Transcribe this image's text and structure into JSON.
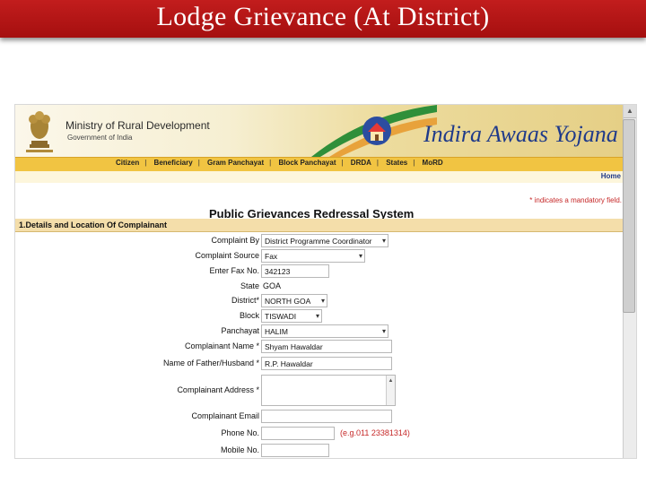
{
  "slide": {
    "title": "Lodge Grievance (At District)"
  },
  "banner": {
    "ministry": "Ministry of Rural Development",
    "government": "Government of India",
    "scheme_title": "Indira Awaas Yojana"
  },
  "nav": {
    "items": [
      "Citizen",
      "Beneficiary",
      "Gram Panchayat",
      "Block Panchayat",
      "DRDA",
      "States",
      "MoRD"
    ],
    "home": "Home"
  },
  "form": {
    "required_note": "* indicates a mandatory field.",
    "page_title": "Public Grievances Redressal System",
    "section_title": "1.Details and Location Of Complainant",
    "fields": {
      "complaint_by": {
        "label": "Complaint By",
        "value": "District Programme Coordinator"
      },
      "complaint_source": {
        "label": "Complaint Source",
        "value": "Fax"
      },
      "fax_no": {
        "label": "Enter Fax No.",
        "value": "342123"
      },
      "state": {
        "label": "State",
        "value": "GOA"
      },
      "district": {
        "label": "District*",
        "value": "NORTH GOA"
      },
      "block": {
        "label": "Block",
        "value": "TISWADI"
      },
      "panchayat": {
        "label": "Panchayat",
        "value": "HALIM"
      },
      "complainant_name": {
        "label": "Complainant Name *",
        "value": "Shyam Hawaldar"
      },
      "father_husband": {
        "label": "Name of Father/Husband *",
        "value": "R.P. Hawaldar"
      },
      "address": {
        "label": "Complainant Address *",
        "value": ""
      },
      "email": {
        "label": "Complainant Email",
        "value": ""
      },
      "phone": {
        "label": "Phone No.",
        "value": "",
        "hint": "(e.g.011 23381314)"
      },
      "mobile": {
        "label": "Mobile No.",
        "value": ""
      }
    }
  }
}
